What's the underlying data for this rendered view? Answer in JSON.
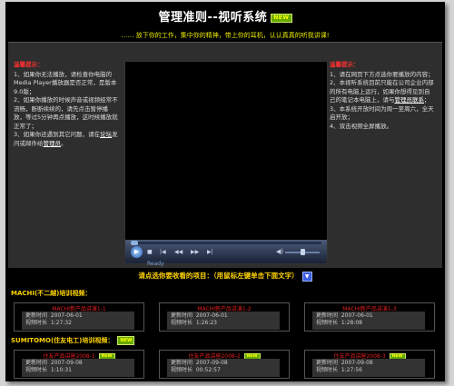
{
  "header": {
    "title": "管理准则--视听系统",
    "title_badge": "NEW",
    "slogan": "…… 放下你的工作，集中你的精神，带上你的耳机，认认真真的听我讲课!"
  },
  "tips_left": {
    "heading": "温馨提示：",
    "items": [
      "1、如果你无法播放，请检查你电脑的Media Player播放器是否正常，是版本9.0版；",
      "2、如果你播放的时候声音或视频经常不流畅，断断续续的，请先点击暂停播放，等过5分钟再点播放，这时候播放就正常了；",
      "3、如果你还遇到其它问题，请在"
    ],
    "link_forum": "论坛",
    "mid_text": "发问或邮件给",
    "link_admin": "管理员",
    "end_text": "。"
  },
  "tips_right": {
    "heading": "温馨提示：",
    "items": [
      "1、请在网页下方点选你要播放的内容；",
      "2、本视听系统目前只能在公司企业内部的所有电脑上运行，如果你想得见到自己的笔记本电脑上，请与",
      "3、本系统开放时间为周一至周六，全天启开放；",
      "4、双击视频全屏播放。"
    ],
    "link_admin": "管理员联系",
    "link_suffix": "；"
  },
  "player": {
    "status": "Ready",
    "progress": 0.0,
    "volume": 0.5
  },
  "select_bar": {
    "label": "请点选你要收看的项目：（用鼠标左键单击下面文字）"
  },
  "sections": [
    {
      "heading": "MACHI(不二越)培训视频：",
      "has_badge": false,
      "videos": [
        {
          "title": "MACHI新产品讲演1-1",
          "updated_label": "更新时间",
          "updated": "2007-06-01",
          "duration_label": "视频时长",
          "duration": "1:27:32"
        },
        {
          "title": "MACHI新产品讲演1-2",
          "updated_label": "更新时间",
          "updated": "2007-06-01",
          "duration_label": "视频时长",
          "duration": "1:26:23"
        },
        {
          "title": "MACHI新产品讲演1-3",
          "updated_label": "更新时间",
          "updated": "2007-06-01",
          "duration_label": "视频时长",
          "duration": "1:28:08"
        }
      ]
    },
    {
      "heading": "SUMITOMO(住友电工)培训视频：",
      "has_badge": true,
      "badge": "NEW",
      "videos": [
        {
          "title": "住友产品讲座2008-1",
          "badge": "NEW",
          "updated_label": "更新时间",
          "updated": "2007-09-08",
          "duration_label": "视频时长",
          "duration": "1:10:31"
        },
        {
          "title": "住友产品讲座2008-2",
          "badge": "NEW",
          "updated_label": "更新时间",
          "updated": "2007-09-08",
          "duration_label": "视频时长",
          "duration": "00:52:57"
        },
        {
          "title": "住友产品讲座2008-3",
          "badge": "NEW",
          "updated_label": "更新时间",
          "updated": "2007-09-08",
          "duration_label": "视频时长",
          "duration": "1:27:56"
        }
      ]
    }
  ]
}
